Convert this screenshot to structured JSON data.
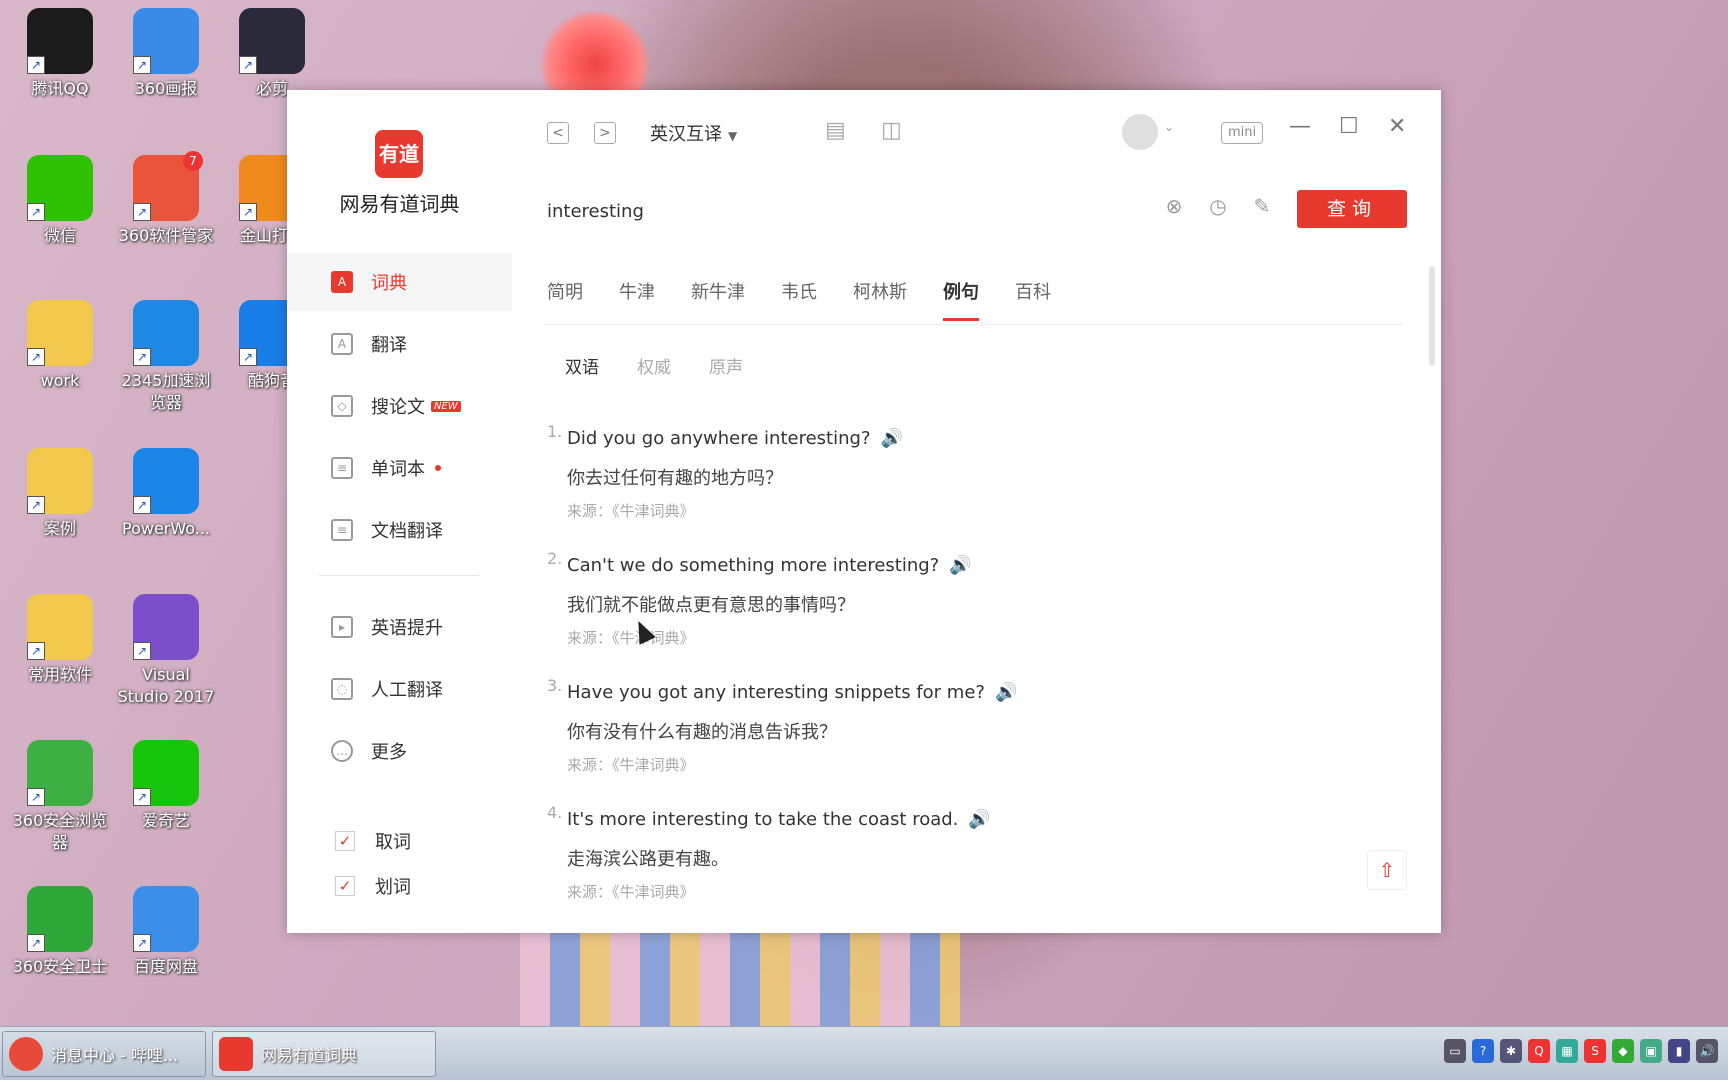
{
  "desktop": {
    "icons": [
      {
        "label": "腾讯QQ",
        "color": "#1b1b1b"
      },
      {
        "label": "360画报",
        "color": "#3a8be8"
      },
      {
        "label": "必剪",
        "color": "#2a2a3a"
      },
      {
        "label": "微信",
        "color": "#2dc100"
      },
      {
        "label": "360软件管家",
        "color": "#e8553a",
        "badge": "7"
      },
      {
        "label": "金山打字",
        "color": "#f08a1c"
      },
      {
        "label": "work",
        "color": "#f2c94c"
      },
      {
        "label": "2345加速浏览器",
        "color": "#1e88e5"
      },
      {
        "label": "酷狗音",
        "color": "#1a7ee8"
      },
      {
        "label": "案例",
        "color": "#f2c94c"
      },
      {
        "label": "PowerWo...",
        "color": "#1c86e8"
      },
      {
        "label": "常用软件",
        "color": "#f2c94c"
      },
      {
        "label": "Visual Studio 2017",
        "color": "#7b4fc9"
      },
      {
        "label": "360安全浏览器",
        "color": "#3cb043"
      },
      {
        "label": "爱奇艺",
        "color": "#16c60c"
      },
      {
        "label": "360安全卫士",
        "color": "#2fa83a"
      },
      {
        "label": "百度网盘",
        "color": "#3b8fe8"
      }
    ]
  },
  "app": {
    "logo_text": "有道",
    "title": "网易有道词典",
    "nav": [
      {
        "label": "词典",
        "icon": "A"
      },
      {
        "label": "翻译",
        "icon": "A"
      },
      {
        "label": "搜论文",
        "icon": "◇",
        "badge": "NEW"
      },
      {
        "label": "单词本",
        "icon": "≡"
      },
      {
        "label": "文档翻译",
        "icon": "≡"
      },
      {
        "label": "英语提升",
        "icon": "▸"
      },
      {
        "label": "人工翻译",
        "icon": "◌"
      },
      {
        "label": "更多",
        "icon": "…"
      }
    ],
    "checks": [
      {
        "label": "取词",
        "mark": "✓"
      },
      {
        "label": "划词",
        "mark": "✓"
      }
    ],
    "topbar": {
      "back": "<",
      "forward": ">",
      "mode": "英汉互译",
      "mode_caret": "▼",
      "doc_icon": "▤",
      "screenshot_icon": "◫",
      "avatar_caret": "⌄",
      "mini": "mini",
      "minimize": "—",
      "maximize": "☐",
      "close": "✕"
    },
    "search": {
      "value": "interesting",
      "clear_icon": "⊗",
      "history_icon": "◷",
      "edit_icon": "✎",
      "button": "查询"
    },
    "tabs": [
      "简明",
      "牛津",
      "新牛津",
      "韦氏",
      "柯林斯",
      "例句",
      "百科"
    ],
    "subtabs": [
      "双语",
      "权威",
      "原声"
    ],
    "examples": [
      {
        "num": "1.",
        "en": "Did you go anywhere interesting?",
        "zh": "你去过任何有趣的地方吗？",
        "src": "来源：《牛津词典》"
      },
      {
        "num": "2.",
        "en": "Can't we do something more interesting?",
        "zh": "我们就不能做点更有意思的事情吗？",
        "src": "来源：《牛津词典》"
      },
      {
        "num": "3.",
        "en": "Have you got any interesting snippets for me?",
        "zh": "你有没有什么有趣的消息告诉我？",
        "src": "来源：《牛津词典》"
      },
      {
        "num": "4.",
        "en": "It's more interesting to take the coast road.",
        "zh": "走海滨公路更有趣。",
        "src": "来源：《牛津词典》"
      }
    ],
    "speaker_icon": "🔊",
    "to_top_icon": "⇧"
  },
  "taskbar": {
    "tasks": [
      {
        "label": "消息中心 - 哔哩...",
        "icon_color": "#e84a3a"
      },
      {
        "label": "网易有道词典",
        "icon_color": "#e8392e"
      }
    ],
    "tray": [
      "▭",
      "?",
      "✱",
      "Q",
      "▦",
      "S",
      "◆",
      "▣",
      "▮",
      "🔊"
    ]
  }
}
